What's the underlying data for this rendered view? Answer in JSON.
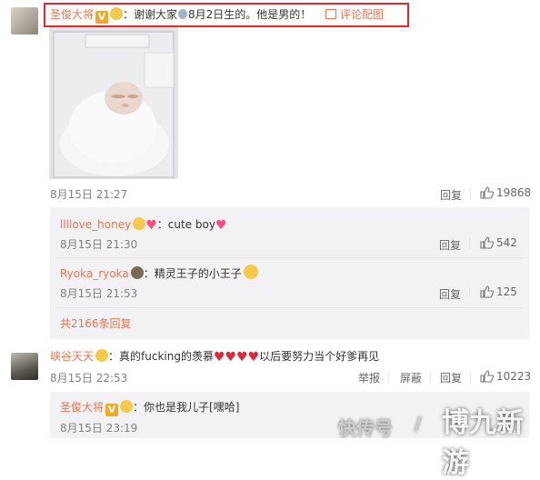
{
  "post": {
    "author": "圣俊大将",
    "text_before": "：谢谢大家",
    "text_after": "8月2日生的。他是男的！",
    "pic_link": "评论配图",
    "time": "8月15日 21:27",
    "reply_label": "回复",
    "likes": "19868"
  },
  "replies": [
    {
      "author": "llllove_honey",
      "text": "：cute boy",
      "time": "8月15日 21:30",
      "reply_label": "回复",
      "likes": "542"
    },
    {
      "author": "Ryoka_ryoka",
      "text": "：精灵王子的小王子",
      "time": "8月15日 21:53",
      "reply_label": "回复",
      "likes": "125"
    }
  ],
  "reply_count": "共2166条回复",
  "comment2": {
    "author": "峡谷天天",
    "text_before": "：真的fucking的羡慕",
    "text_after": "以后要努力当个好爹再见",
    "time": "8月15日 22:53",
    "report_label": "举报",
    "block_label": "屏蔽",
    "reply_label": "回复",
    "likes": "10223"
  },
  "reply3": {
    "author": "圣俊大将",
    "text": "：你也是我儿子[嘿哈]",
    "time": "8月15日 23:19"
  },
  "watermarks": {
    "left": "快传号",
    "mid": "/",
    "right": "博九新游"
  },
  "colors": {
    "name": "#eb7350",
    "highlight": "#e8262a",
    "sub_bg": "#f2f2f5"
  }
}
